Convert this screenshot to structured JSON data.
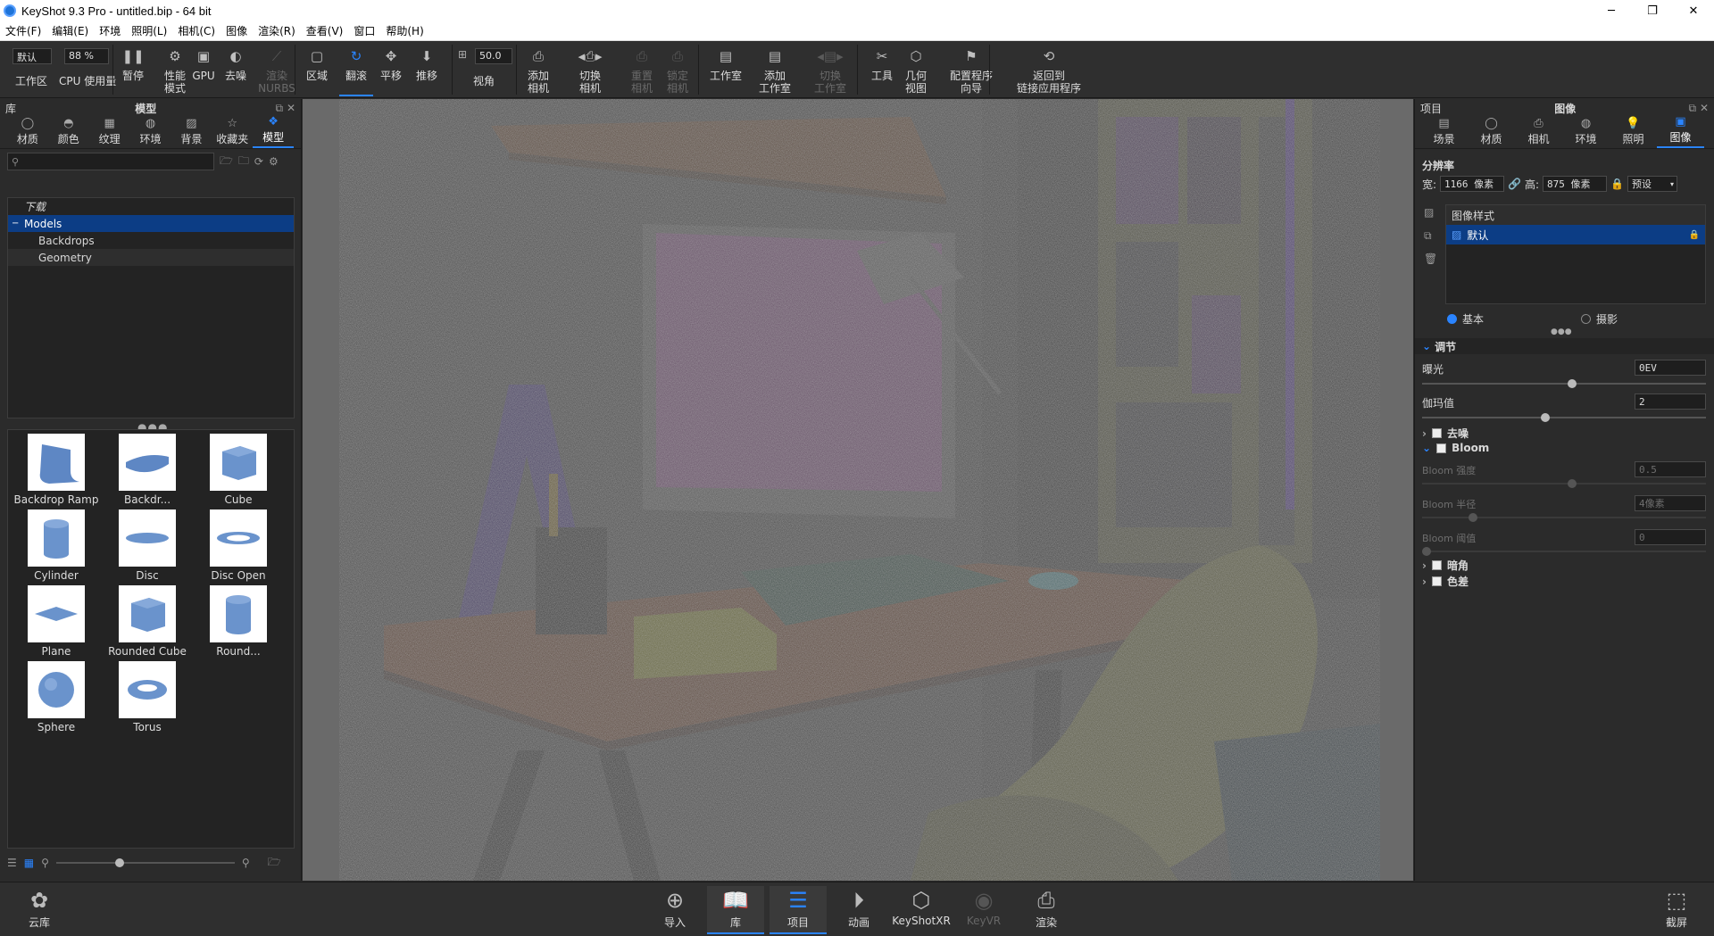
{
  "window": {
    "title": "KeyShot 9.3 Pro  - untitled.bip  - 64 bit",
    "controls": [
      "─",
      "❐",
      "✕"
    ]
  },
  "menu": [
    "文件(F)",
    "编辑(E)",
    "环境",
    "照明(L)",
    "相机(C)",
    "图像",
    "渲染(R)",
    "查看(V)",
    "窗口",
    "帮助(H)"
  ],
  "toolbar": {
    "workspace_select": "默认",
    "workspace_label": "工作区",
    "cpu_select": "88 %",
    "cpu_label": "CPU 使用量",
    "fov_value": "50.0",
    "fov_label": "视角",
    "items": [
      {
        "id": "pause",
        "label1": "暂停",
        "label2": "",
        "icon": "❚❚",
        "state": "normal"
      },
      {
        "id": "perf",
        "label1": "性能",
        "label2": "模式",
        "icon": "⚙",
        "state": "normal"
      },
      {
        "id": "gpu",
        "label1": "GPU",
        "label2": "",
        "icon": "▣",
        "state": "normal"
      },
      {
        "id": "denoise",
        "label1": "去噪",
        "label2": "",
        "icon": "◐",
        "state": "normal"
      },
      {
        "id": "nurbs",
        "label1": "渲染",
        "label2": "NURBS",
        "icon": "⟋",
        "state": "disabled"
      },
      {
        "id": "region",
        "label1": "区域",
        "label2": "",
        "icon": "▢",
        "state": "normal"
      },
      {
        "id": "tumble",
        "label1": "翻滚",
        "label2": "",
        "icon": "↻",
        "state": "active"
      },
      {
        "id": "pan",
        "label1": "平移",
        "label2": "",
        "icon": "✥",
        "state": "normal"
      },
      {
        "id": "dolly",
        "label1": "推移",
        "label2": "",
        "icon": "⬇",
        "state": "normal"
      },
      {
        "id": "add_camera",
        "label1": "添加",
        "label2": "相机",
        "icon": "⎙",
        "state": "normal"
      },
      {
        "id": "switch_camera",
        "label1": "切换",
        "label2": "相机",
        "icon": "◂⎙▸",
        "state": "normal"
      },
      {
        "id": "reset_camera",
        "label1": "重置",
        "label2": "相机",
        "icon": "⎙",
        "state": "disabled"
      },
      {
        "id": "lock_camera",
        "label1": "锁定",
        "label2": "相机",
        "icon": "⎙",
        "state": "disabled"
      },
      {
        "id": "studio",
        "label1": "工作室",
        "label2": "",
        "icon": "▤",
        "state": "normal"
      },
      {
        "id": "add_studio",
        "label1": "添加",
        "label2": "工作室",
        "icon": "▤",
        "state": "normal"
      },
      {
        "id": "switch_studio",
        "label1": "切换",
        "label2": "工作室",
        "icon": "◂▤▸",
        "state": "disabled"
      },
      {
        "id": "tools",
        "label1": "工具",
        "label2": "",
        "icon": "✂",
        "state": "normal"
      },
      {
        "id": "geo_view",
        "label1": "几何",
        "label2": "视图",
        "icon": "⬡",
        "state": "normal"
      },
      {
        "id": "config_wizard",
        "label1": "配置程序",
        "label2": "向导",
        "icon": "⚑",
        "state": "normal"
      },
      {
        "id": "return_linked",
        "label1": "返回到",
        "label2": "链接应用程序",
        "icon": "⟲",
        "state": "normal"
      }
    ]
  },
  "library": {
    "title_left": "库",
    "title_center": "模型",
    "tabs": [
      {
        "label": "材质",
        "icon": "◯"
      },
      {
        "label": "颜色",
        "icon": "◓"
      },
      {
        "label": "纹理",
        "icon": "▦"
      },
      {
        "label": "环境",
        "icon": "◍"
      },
      {
        "label": "背景",
        "icon": "▨"
      },
      {
        "label": "收藏夹",
        "icon": "☆"
      },
      {
        "label": "模型",
        "icon": "❖"
      }
    ],
    "search_placeholder": "",
    "tree": [
      {
        "label": "下载",
        "level": 1,
        "style": "italic",
        "state": "normal"
      },
      {
        "label": "Models",
        "level": 1,
        "style": "normal",
        "state": "selected"
      },
      {
        "label": "Backdrops",
        "level": 2,
        "style": "normal",
        "state": "normal"
      },
      {
        "label": "Geometry",
        "level": 2,
        "style": "normal",
        "state": "alt"
      }
    ],
    "models": [
      {
        "label": "Backdrop Ramp",
        "shape": "ramp"
      },
      {
        "label": "Backdr...",
        "shape": "curve"
      },
      {
        "label": "Cube",
        "shape": "cube"
      },
      {
        "label": "Cylinder",
        "shape": "cylinder"
      },
      {
        "label": "Disc",
        "shape": "disc"
      },
      {
        "label": "Disc Open",
        "shape": "ring"
      },
      {
        "label": "Plane",
        "shape": "plane"
      },
      {
        "label": "Rounded Cube",
        "shape": "cube"
      },
      {
        "label": "Round...",
        "shape": "cylinder"
      },
      {
        "label": "Sphere",
        "shape": "sphere"
      },
      {
        "label": "Torus",
        "shape": "torus"
      }
    ]
  },
  "project": {
    "title_left": "项目",
    "title_center": "图像",
    "tabs": [
      {
        "label": "场景",
        "icon": "▤"
      },
      {
        "label": "材质",
        "icon": "◯"
      },
      {
        "label": "相机",
        "icon": "⎙"
      },
      {
        "label": "环境",
        "icon": "◍"
      },
      {
        "label": "照明",
        "icon": "💡"
      },
      {
        "label": "图像",
        "icon": "▣"
      }
    ],
    "resolution_label": "分辨率",
    "width_label": "宽:",
    "width_value": "1166 像素",
    "height_label": "高:",
    "height_value": "875 像素",
    "preset": "预设",
    "image_styles_header": "图像样式",
    "image_style_default": "默认",
    "mode_basic": "基本",
    "mode_photo": "摄影",
    "adjust_header": "调节",
    "exposure_label": "曝光",
    "exposure_value": "0EV",
    "gamma_label": "伽玛值",
    "gamma_value": "2",
    "denoise_label": "去噪",
    "bloom_label": "Bloom",
    "bloom_intensity_label": "Bloom 强度",
    "bloom_intensity_value": "0.5",
    "bloom_radius_label": "Bloom 半径",
    "bloom_radius_value": "4像素",
    "bloom_threshold_label": "Bloom 阈值",
    "bloom_threshold_value": "0",
    "vignette_label": "暗角",
    "chroma_label": "色差"
  },
  "bottombar": {
    "cloud_label": "云库",
    "items": [
      {
        "label": "导入",
        "icon": "⊕",
        "state": "normal"
      },
      {
        "label": "库",
        "icon": "📖",
        "state": "active"
      },
      {
        "label": "项目",
        "icon": "☰",
        "state": "active"
      },
      {
        "label": "动画",
        "icon": "⏵",
        "state": "normal"
      },
      {
        "label": "KeyShotXR",
        "icon": "⬡",
        "state": "normal"
      },
      {
        "label": "KeyVR",
        "icon": "◉",
        "state": "disabled"
      },
      {
        "label": "渲染",
        "icon": "⎙",
        "state": "normal"
      }
    ],
    "screenshot_label": "截屏"
  },
  "colors": {
    "accent": "#2a84ff",
    "selection": "#0c3d85",
    "panel": "#2b2b2b"
  }
}
